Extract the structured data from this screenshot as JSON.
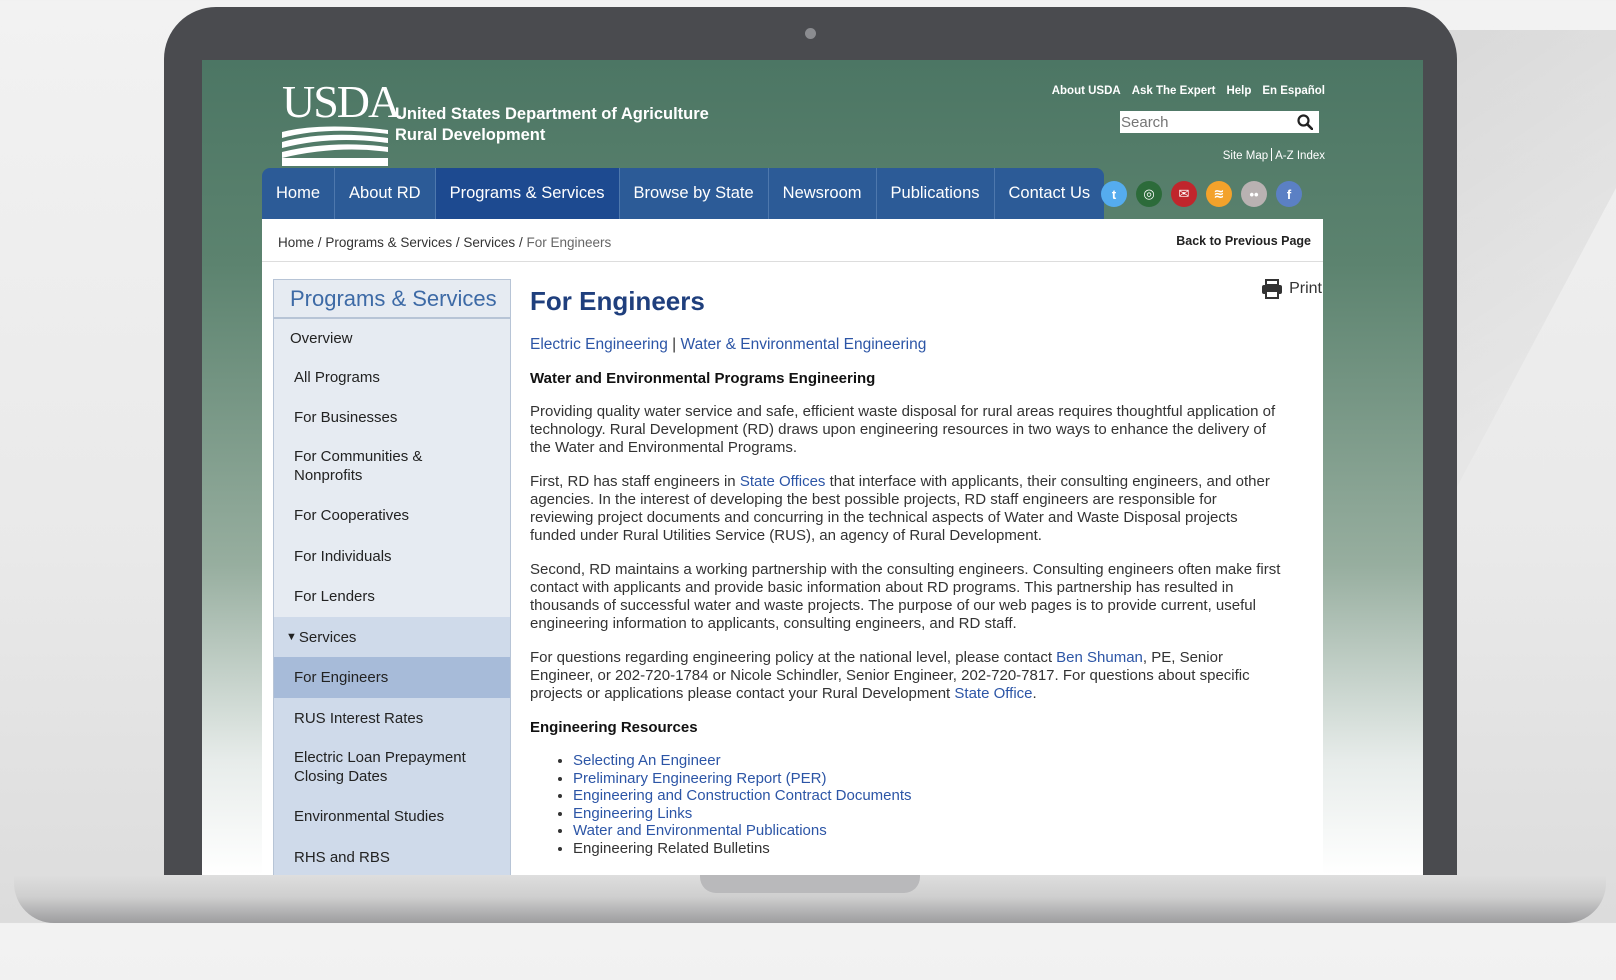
{
  "site": {
    "logo_text": "USDA",
    "agency_line1": "United States Department of Agriculture",
    "agency_line2": "Rural Development"
  },
  "utility_links": [
    "About USDA",
    "Ask The Expert",
    "Help",
    "En Español"
  ],
  "search": {
    "placeholder": "Search"
  },
  "sitemap": {
    "site_map": "Site Map",
    "az_index": "A-Z Index"
  },
  "nav": {
    "items": [
      "Home",
      "About RD",
      "Programs & Services",
      "Browse by State",
      "Newsroom",
      "Publications",
      "Contact Us"
    ],
    "active": "Programs & Services"
  },
  "social_icons": [
    {
      "name": "twitter-icon",
      "color": "#55acee",
      "glyph": "t"
    },
    {
      "name": "govdelivery-icon",
      "color": "#2c6b3a",
      "glyph": "◎"
    },
    {
      "name": "email-icon",
      "color": "#c0262c",
      "glyph": "✉"
    },
    {
      "name": "rss-icon",
      "color": "#f3a22b",
      "glyph": "≋"
    },
    {
      "name": "flickr-icon",
      "color": "#b9b2b2",
      "glyph": "••"
    },
    {
      "name": "facebook-icon",
      "color": "#5b80c4",
      "glyph": "f"
    }
  ],
  "breadcrumb": {
    "items": [
      "Home",
      "Programs & Services",
      "Services"
    ],
    "current": "For Engineers",
    "separator": "/",
    "back_link": "Back to Previous Page"
  },
  "sidebar": {
    "title": "Programs & Services",
    "items": [
      "Overview",
      "All Programs",
      "For Businesses",
      "For Communities & Nonprofits",
      "For Cooperatives",
      "For Individuals",
      "For Lenders"
    ],
    "section_head": "Services",
    "section_marker": "▼",
    "sub_items": [
      "For Engineers",
      "RUS Interest Rates",
      "Electric Loan Prepayment Closing Dates",
      "Environmental Studies",
      "RHS and RBS"
    ],
    "current": "For Engineers"
  },
  "main": {
    "title": "For Engineers",
    "print_label": "Print",
    "topic_links": [
      "Electric Engineering",
      "Water & Environmental Engineering"
    ],
    "topic_sep": "|",
    "heading1": "Water and Environmental Programs Engineering",
    "para1": "Providing quality water service and safe, efficient waste disposal for rural areas requires thoughtful application of technology. Rural Development (RD) draws upon engineering resources in two ways to enhance the delivery of the Water and Environmental Programs.",
    "para2_before": "First, RD has staff engineers in ",
    "para2_link": "State Offices",
    "para2_after": " that interface with applicants, their consulting engineers, and other agencies. In the interest of developing the best possible projects, RD staff engineers are responsible for reviewing project documents and concurring in the technical aspects of Water and Waste Disposal projects funded under Rural Utilities Service (RUS), an agency of Rural Development.",
    "para3": "Second, RD maintains a working partnership with the consulting engineers. Consulting engineers often make first contact with applicants and provide basic information about RD programs. This partnership has resulted in thousands of successful water and waste projects. The purpose of our web pages is to provide current, useful engineering information to applicants, consulting engineers, and RD staff.",
    "para4_before": "For questions regarding engineering policy at the national level, please contact ",
    "para4_link1": "Ben Shuman",
    "para4_mid": ", PE, Senior Engineer, or 202-720-1784 or Nicole Schindler, Senior Engineer, 202-720-7817. For questions about specific projects or applications please contact your Rural Development ",
    "para4_link2": "State Office",
    "para4_end": ".",
    "heading2": "Engineering Resources",
    "resources": [
      {
        "label": "Selecting An Engineer",
        "link": true
      },
      {
        "label": "Preliminary Engineering Report (PER)",
        "link": true
      },
      {
        "label": "Engineering and Construction Contract Documents",
        "link": true
      },
      {
        "label": "Engineering Links",
        "link": true
      },
      {
        "label": "Water and Environmental Publications",
        "link": true
      },
      {
        "label": "Engineering Related Bulletins",
        "link": false
      }
    ]
  },
  "colors": {
    "header_green": "#4c7664",
    "nav_blue": "#2c5b97",
    "nav_active": "#1d4a90",
    "title_blue": "#1f3f7d",
    "link_blue": "#2c55a6",
    "sidebar_bg": "#e6ebf2",
    "sidebar_current": "#a7bbd9"
  }
}
